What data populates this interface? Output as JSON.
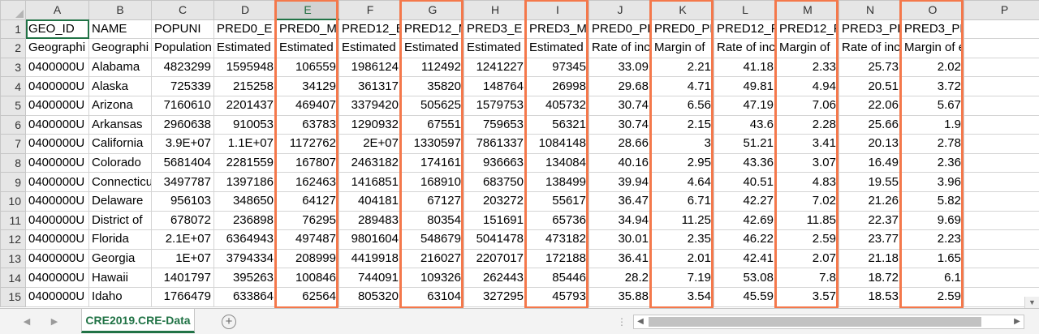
{
  "sheet_tab": "CRE2019.CRE-Data",
  "columns": [
    "A",
    "B",
    "C",
    "D",
    "E",
    "F",
    "G",
    "H",
    "I",
    "J",
    "K",
    "L",
    "M",
    "N",
    "O",
    "P"
  ],
  "selected_column": "E",
  "highlighted_columns": [
    "E",
    "G",
    "I",
    "K",
    "M",
    "O"
  ],
  "highlight_color": "#f4784b",
  "accent_color": "#217346",
  "rows": [
    {
      "n": "1",
      "cells": [
        "GEO_ID",
        "NAME",
        "POPUNI",
        "PRED0_E",
        "PRED0_M",
        "PRED12_E",
        "PRED12_M",
        "PRED3_E",
        "PRED3_M",
        "PRED0_PE",
        "PRED0_PM",
        "PRED12_P",
        "PRED12_P",
        "PRED3_PE",
        "PRED3_PM",
        ""
      ]
    },
    {
      "n": "2",
      "cells": [
        "Geographi",
        "Geographi",
        "Population",
        "Estimated",
        "Estimated",
        "Estimated",
        "Estimated",
        "Estimated",
        "Estimated",
        "Rate of inc",
        "Margin of",
        "Rate of inc",
        "Margin of",
        "Rate of inc",
        "Margin of error for th",
        ""
      ]
    },
    {
      "n": "3",
      "cells": [
        "0400000U",
        "Alabama",
        "4823299",
        "1595948",
        "106559",
        "1986124",
        "112492",
        "1241227",
        "97345",
        "33.09",
        "2.21",
        "41.18",
        "2.33",
        "25.73",
        "2.02",
        ""
      ]
    },
    {
      "n": "4",
      "cells": [
        "0400000U",
        "Alaska",
        "725339",
        "215258",
        "34129",
        "361317",
        "35820",
        "148764",
        "26998",
        "29.68",
        "4.71",
        "49.81",
        "4.94",
        "20.51",
        "3.72",
        ""
      ]
    },
    {
      "n": "5",
      "cells": [
        "0400000U",
        "Arizona",
        "7160610",
        "2201437",
        "469407",
        "3379420",
        "505625",
        "1579753",
        "405732",
        "30.74",
        "6.56",
        "47.19",
        "7.06",
        "22.06",
        "5.67",
        ""
      ]
    },
    {
      "n": "6",
      "cells": [
        "0400000U",
        "Arkansas",
        "2960638",
        "910053",
        "63783",
        "1290932",
        "67551",
        "759653",
        "56321",
        "30.74",
        "2.15",
        "43.6",
        "2.28",
        "25.66",
        "1.9",
        ""
      ]
    },
    {
      "n": "7",
      "cells": [
        "0400000U",
        "California",
        "3.9E+07",
        "1.1E+07",
        "1172762",
        "2E+07",
        "1330597",
        "7861337",
        "1084148",
        "28.66",
        "3",
        "51.21",
        "3.41",
        "20.13",
        "2.78",
        ""
      ]
    },
    {
      "n": "8",
      "cells": [
        "0400000U",
        "Colorado",
        "5681404",
        "2281559",
        "167807",
        "2463182",
        "174161",
        "936663",
        "134084",
        "40.16",
        "2.95",
        "43.36",
        "3.07",
        "16.49",
        "2.36",
        ""
      ]
    },
    {
      "n": "9",
      "cells": [
        "0400000U",
        "Connecticu",
        "3497787",
        "1397186",
        "162463",
        "1416851",
        "168910",
        "683750",
        "138499",
        "39.94",
        "4.64",
        "40.51",
        "4.83",
        "19.55",
        "3.96",
        ""
      ]
    },
    {
      "n": "10",
      "cells": [
        "0400000U",
        "Delaware",
        "956103",
        "348650",
        "64127",
        "404181",
        "67127",
        "203272",
        "55617",
        "36.47",
        "6.71",
        "42.27",
        "7.02",
        "21.26",
        "5.82",
        ""
      ]
    },
    {
      "n": "11",
      "cells": [
        "0400000U",
        "District of",
        "678072",
        "236898",
        "76295",
        "289483",
        "80354",
        "151691",
        "65736",
        "34.94",
        "11.25",
        "42.69",
        "11.85",
        "22.37",
        "9.69",
        ""
      ]
    },
    {
      "n": "12",
      "cells": [
        "0400000U",
        "Florida",
        "2.1E+07",
        "6364943",
        "497487",
        "9801604",
        "548679",
        "5041478",
        "473182",
        "30.01",
        "2.35",
        "46.22",
        "2.59",
        "23.77",
        "2.23",
        ""
      ]
    },
    {
      "n": "13",
      "cells": [
        "0400000U",
        "Georgia",
        "1E+07",
        "3794334",
        "208999",
        "4419918",
        "216027",
        "2207017",
        "172188",
        "36.41",
        "2.01",
        "42.41",
        "2.07",
        "21.18",
        "1.65",
        ""
      ]
    },
    {
      "n": "14",
      "cells": [
        "0400000U",
        "Hawaii",
        "1401797",
        "395263",
        "100846",
        "744091",
        "109326",
        "262443",
        "85446",
        "28.2",
        "7.19",
        "53.08",
        "7.8",
        "18.72",
        "6.1",
        ""
      ]
    },
    {
      "n": "15",
      "cells": [
        "0400000U",
        "Idaho",
        "1766479",
        "633864",
        "62564",
        "805320",
        "63104",
        "327295",
        "45793",
        "35.88",
        "3.54",
        "45.59",
        "3.57",
        "18.53",
        "2.59",
        ""
      ]
    }
  ],
  "icons": {
    "nav_prev": "triangle-left-icon",
    "nav_next": "triangle-right-icon",
    "add_sheet": "plus-circle-icon",
    "scroll_left": "triangle-left-icon",
    "scroll_right": "triangle-right-icon",
    "scroll_down": "triangle-down-icon"
  }
}
